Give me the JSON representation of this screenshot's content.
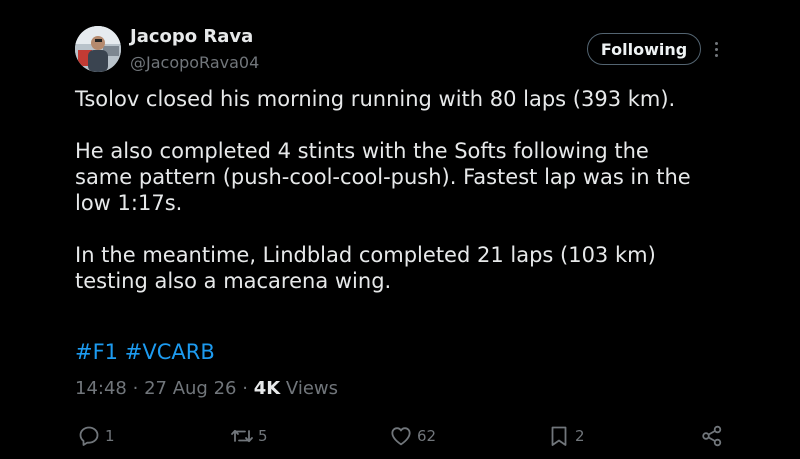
{
  "author": {
    "name": "Jacopo Rava",
    "handle": "@JacopoRava04",
    "avatar_icon": "profile-photo"
  },
  "follow_button": {
    "label": "Following"
  },
  "more_icon": "more-vertical-icon",
  "tweet": {
    "paragraphs": [
      "Tsolov closed his morning running with 80 laps (393 km).",
      "He also completed 4 stints with the Softs following the\nsame pattern (push-cool-cool-push). Fastest lap was in the\nlow 1:17s.",
      "In the meantime, Lindblad completed 21 laps (103 km)\ntesting also a macarena wing."
    ],
    "hashtags": [
      "#F1",
      "#VCARB"
    ]
  },
  "meta": {
    "time": "14:48",
    "date": "27 Aug 26",
    "separator": "·",
    "views_count": "4K",
    "views_label": "Views"
  },
  "actions": {
    "reply": {
      "icon": "reply-icon",
      "count": "1"
    },
    "repost": {
      "icon": "repost-icon",
      "count": "5"
    },
    "like": {
      "icon": "heart-icon",
      "count": "62"
    },
    "bookmark": {
      "icon": "bookmark-icon",
      "count": "2"
    },
    "share": {
      "icon": "share-icon"
    }
  },
  "colors": {
    "background": "#000000",
    "text": "#e7e9ea",
    "secondary": "#71767b",
    "link": "#1d9bf0",
    "button_border": "#536471"
  }
}
